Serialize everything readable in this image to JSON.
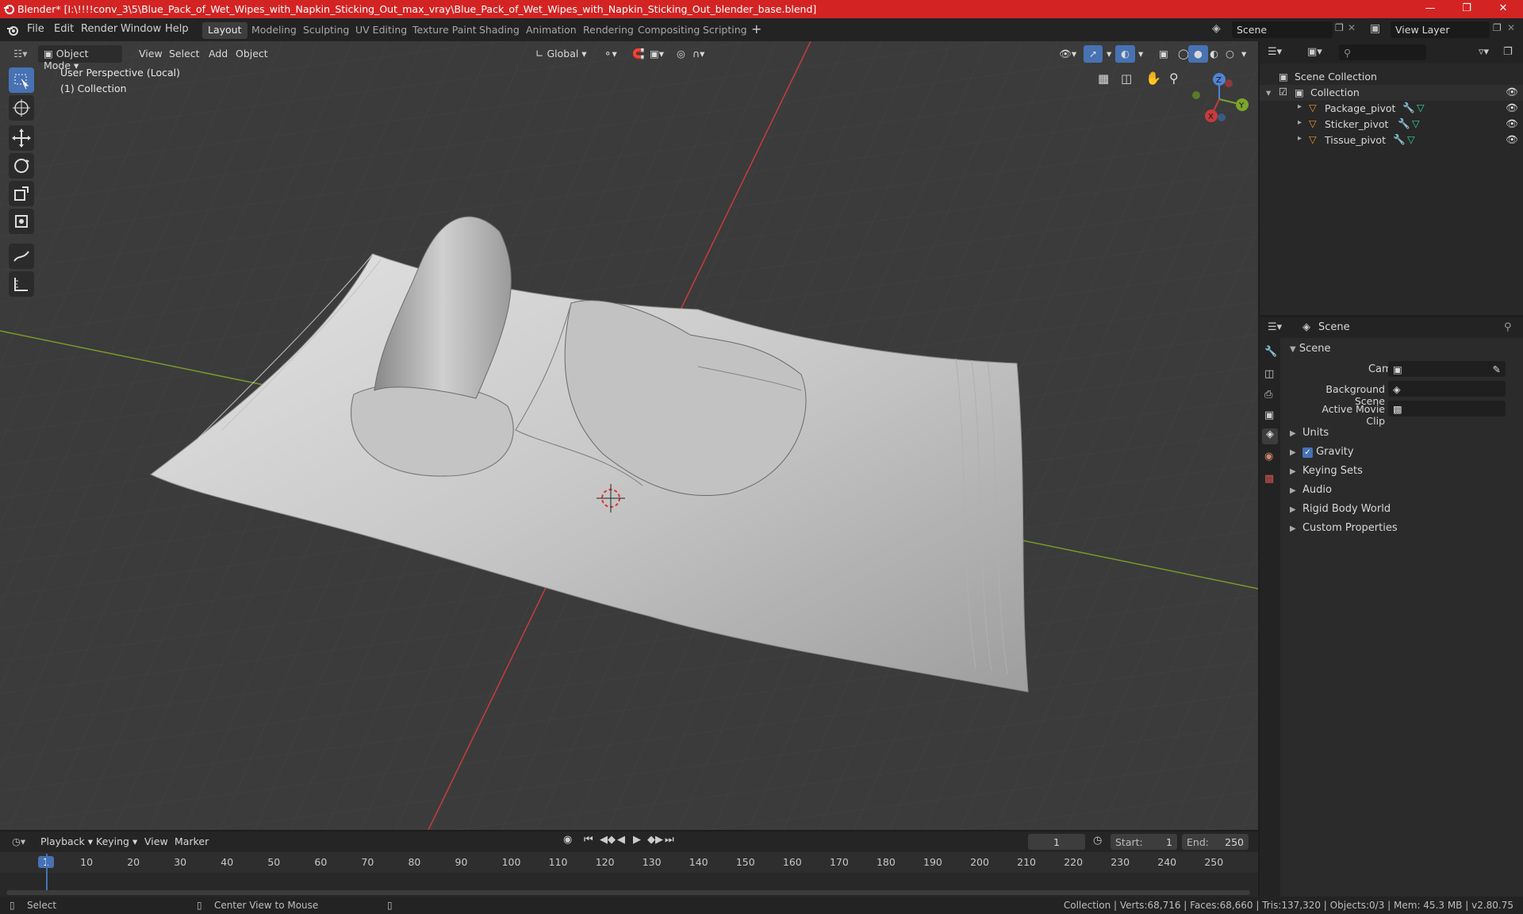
{
  "title": "Blender* [I:\\!!!!conv_3\\5\\Blue_Pack_of_Wet_Wipes_with_Napkin_Sticking_Out_max_vray\\Blue_Pack_of_Wet_Wipes_with_Napkin_Sticking_Out_blender_base.blend]",
  "menu": [
    "File",
    "Edit",
    "Render",
    "Window",
    "Help"
  ],
  "workspaces": [
    "Layout",
    "Modeling",
    "Sculpting",
    "UV Editing",
    "Texture Paint",
    "Shading",
    "Animation",
    "Rendering",
    "Compositing",
    "Scripting"
  ],
  "active_workspace": "Layout",
  "scene_field": "Scene",
  "view_layer_field": "View Layer",
  "viewport": {
    "mode": "Object Mode",
    "menus": [
      "View",
      "Select",
      "Add",
      "Object"
    ],
    "orientation": "Global",
    "perspective": "User Perspective (Local)",
    "collection": "(1) Collection",
    "gizmo": {
      "x": "X",
      "y": "Y",
      "z": "Z"
    }
  },
  "outliner": {
    "root": "Scene Collection",
    "collection": "Collection",
    "items": [
      "Package_pivot",
      "Sticker_pivot",
      "Tissue_pivot"
    ]
  },
  "properties": {
    "header": "Scene",
    "panel": "Scene",
    "camera_label": "Camera",
    "background_label": "Background Scene",
    "movieclip_label": "Active Movie Clip",
    "sections": [
      "Units",
      "Gravity",
      "Keying Sets",
      "Audio",
      "Rigid Body World",
      "Custom Properties"
    ],
    "gravity_checked": true
  },
  "timeline": {
    "menus": [
      "Playback",
      "Keying",
      "View",
      "Marker"
    ],
    "current_frame": "1",
    "start_label": "Start:",
    "start": "1",
    "end_label": "End:",
    "end": "250",
    "ticks": [
      "1",
      "10",
      "20",
      "30",
      "40",
      "50",
      "60",
      "70",
      "80",
      "90",
      "100",
      "110",
      "120",
      "130",
      "140",
      "150",
      "160",
      "170",
      "180",
      "190",
      "200",
      "210",
      "220",
      "230",
      "240",
      "250"
    ]
  },
  "status": {
    "select": "Select",
    "center": "Center View to Mouse",
    "stats": "Collection | Verts:68,716 | Faces:68,660 | Tris:137,320 | Objects:0/3 | Mem: 45.3 MB | v2.80.75"
  },
  "colors": {
    "titlebar": "#d42323",
    "accent": "#4772b3",
    "x_axis": "#c63c3c",
    "y_axis": "#7a9a2a",
    "object_icon": "#e8922a"
  }
}
